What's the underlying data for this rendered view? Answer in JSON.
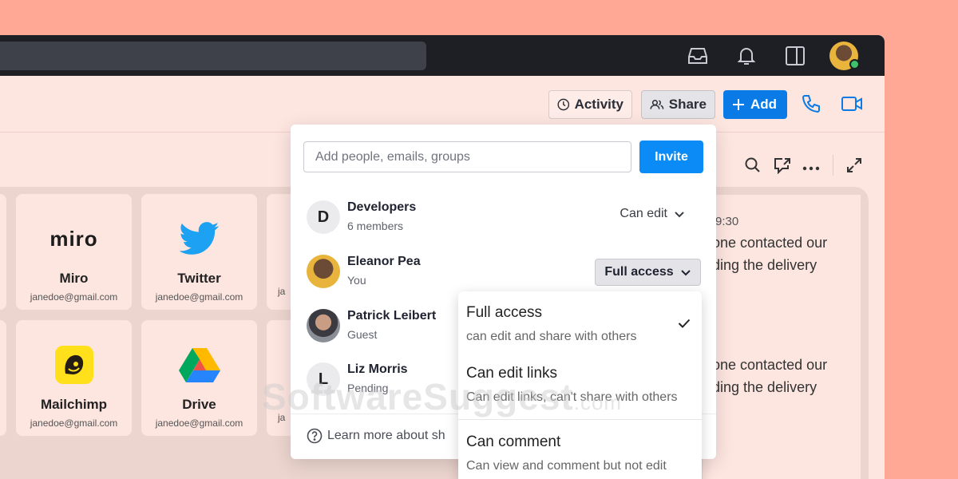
{
  "header": {
    "activity_label": "Activity",
    "share_label": "Share",
    "add_label": "Add"
  },
  "apps": [
    {
      "name": "Miro",
      "email": "janedoe@gmail.com",
      "logo_text": "miro"
    },
    {
      "name": "Twitter",
      "email": "janedoe@gmail.com"
    },
    {
      "name": "Mailchimp",
      "email": "janedoe@gmail.com"
    },
    {
      "name": "Drive",
      "email": "janedoe@gmail.com"
    },
    {
      "name": "",
      "email": "ja"
    },
    {
      "name": "",
      "email": "ja"
    }
  ],
  "chat": {
    "time": "9:30",
    "lines": [
      "one contacted our",
      "ding the delivery",
      "one contacted our",
      "ding the delivery"
    ]
  },
  "share_popover": {
    "input_placeholder": "Add people, emails, groups",
    "invite_label": "Invite",
    "members": [
      {
        "initial": "D",
        "name": "Developers",
        "sub": "6 members",
        "permission": "Can edit"
      },
      {
        "name": "Eleanor Pea",
        "sub": "You",
        "permission": "Full access"
      },
      {
        "name": "Patrick Leibert",
        "sub": "Guest"
      },
      {
        "initial": "L",
        "name": "Liz Morris",
        "sub": "Pending"
      }
    ],
    "learn_more": "Learn more about sh"
  },
  "permission_dropdown": {
    "options": [
      {
        "title": "Full access",
        "desc": "can edit and share with others",
        "selected": true
      },
      {
        "title": "Can edit links",
        "desc": "Can edit links, can't share with others"
      },
      {
        "title": "Can comment",
        "desc": "Can view and comment but not edit"
      }
    ]
  },
  "watermark": {
    "main": "SoftwareSuggest",
    "suffix": ".com"
  },
  "colors": {
    "background": "#FFA895",
    "window": "#FDE5E0",
    "titlebar": "#1E1F24",
    "primary": "#0A7BE6",
    "online": "#3EC26B"
  }
}
